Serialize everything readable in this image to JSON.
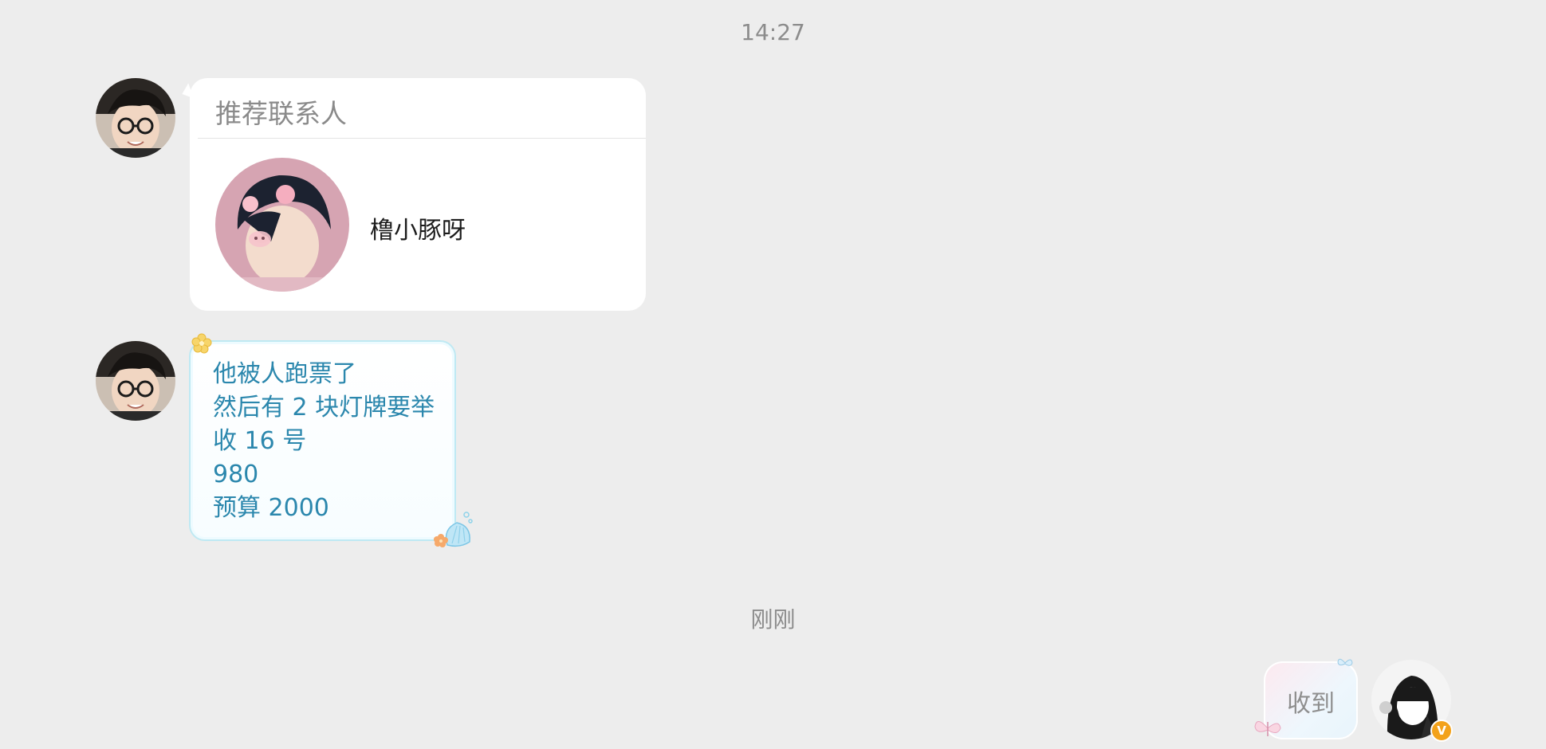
{
  "conversation": {
    "timestamps": {
      "first": "14:27",
      "second": "刚刚"
    },
    "messages": [
      {
        "type": "contact_card",
        "sender": "other",
        "card_title": "推荐联系人",
        "contact_name": "橹小豚呀"
      },
      {
        "type": "text",
        "sender": "other",
        "lines": [
          "他被人跑票了",
          "然后有 2 块灯牌要举",
          "收 16 号",
          "980",
          "预算 2000"
        ]
      },
      {
        "type": "text",
        "sender": "me",
        "text": "收到"
      }
    ]
  },
  "badges": {
    "vip": "V",
    "vip_color": "#f3a21b"
  },
  "colors": {
    "background": "#ededed",
    "bubble_text": "#2b87ad",
    "timestamp": "#8c8c8c"
  }
}
